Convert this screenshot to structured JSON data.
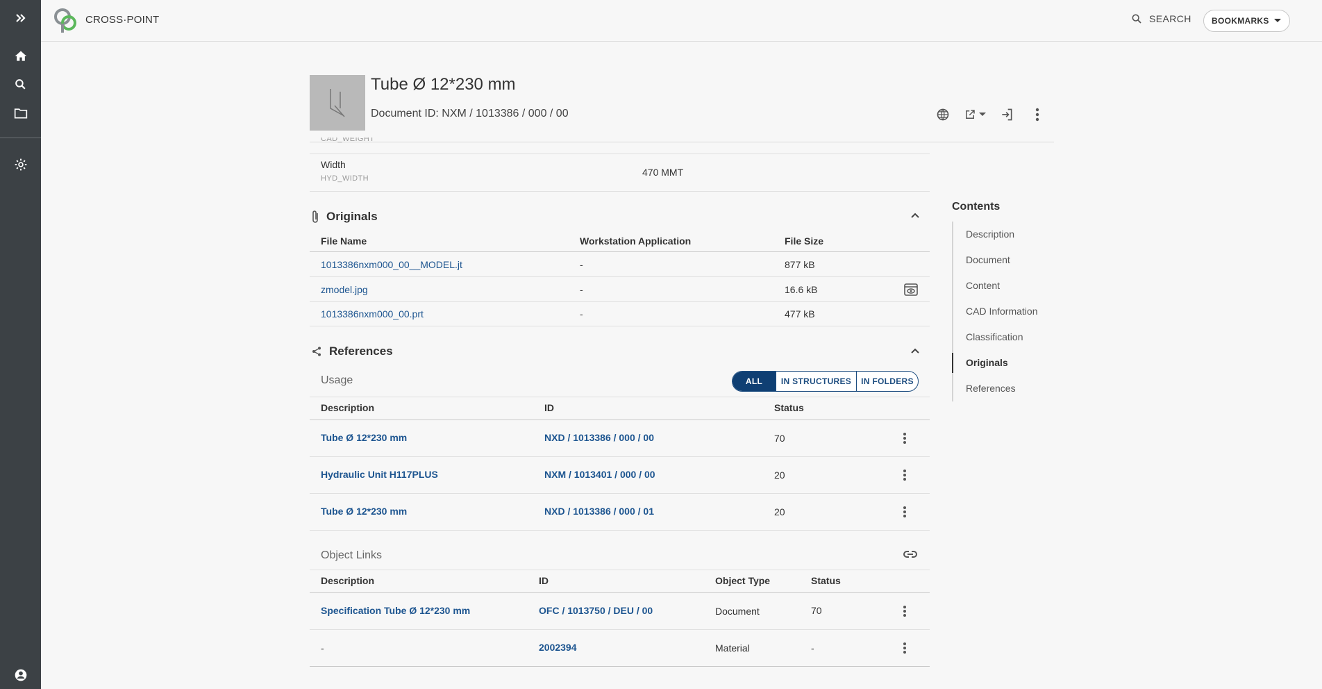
{
  "app": {
    "brand": "CROSS·POINT"
  },
  "topbar": {
    "search_label": "SEARCH",
    "bookmarks_label": "BOOKMARKS"
  },
  "rail": {
    "icons": [
      "expand-icon",
      "home-icon",
      "search-icon",
      "folder-icon",
      "settings-icon",
      "account-icon"
    ]
  },
  "document": {
    "title": "Tube Ø 12*230 mm",
    "id_label": "Document ID: NXM / 1013386 / 000 / 00"
  },
  "attributes": {
    "cut_off_label": "CAD_WEIGHT",
    "width": {
      "label": "Width",
      "key": "HYD_WIDTH",
      "value": "470 MMT"
    }
  },
  "originals": {
    "title": "Originals",
    "columns": [
      "File Name",
      "Workstation Application",
      "File Size"
    ],
    "rows": [
      {
        "name": "1013386nxm000_00__MODEL.jt",
        "app": "-",
        "size": "877 kB"
      },
      {
        "name": "zmodel.jpg",
        "app": "-",
        "size": "16.6 kB"
      },
      {
        "name": "1013386nxm000_00.prt",
        "app": "-",
        "size": "477 kB"
      }
    ]
  },
  "references": {
    "title": "References",
    "usage": {
      "title": "Usage",
      "filters": [
        "ALL",
        "IN STRUCTURES",
        "IN FOLDERS"
      ],
      "columns": [
        "Description",
        "ID",
        "Status"
      ],
      "rows": [
        {
          "description": "Tube Ø 12*230 mm",
          "id": "NXD / 1013386 / 000 / 00",
          "status": "70"
        },
        {
          "description": "Hydraulic Unit H117PLUS",
          "id": "NXM / 1013401 / 000 / 00",
          "status": "20"
        },
        {
          "description": "Tube Ø 12*230 mm",
          "id": "NXD / 1013386 / 000 / 01",
          "status": "20"
        }
      ]
    },
    "object_links": {
      "title": "Object Links",
      "columns": [
        "Description",
        "ID",
        "Object Type",
        "Status"
      ],
      "rows": [
        {
          "description": "Specification Tube Ø 12*230 mm",
          "id": "OFC / 1013750 / DEU / 00",
          "type": "Document",
          "status": "70"
        },
        {
          "description": "-",
          "id": "2002394",
          "type": "Material",
          "status": "-"
        }
      ]
    }
  },
  "contents": {
    "title": "Contents",
    "items": [
      "Description",
      "Document",
      "Content",
      "CAD Information",
      "Classification",
      "Originals",
      "References"
    ],
    "active": "Originals"
  },
  "colors": {
    "rail": "#3c4145",
    "link": "#1d5590",
    "accent": "#0f3f73"
  }
}
